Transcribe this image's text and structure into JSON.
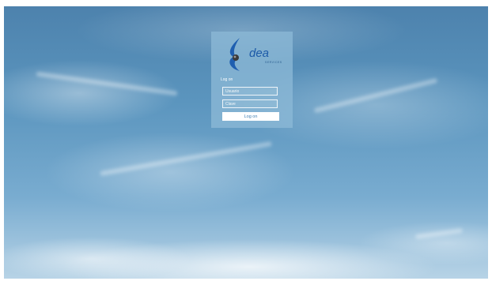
{
  "login": {
    "logo": {
      "name": "dea",
      "tagline": "SERVICES"
    },
    "heading": "Log on",
    "username": {
      "placeholder": "Usuario",
      "value": ""
    },
    "password": {
      "placeholder": "Clave",
      "value": ""
    },
    "submit_label": "Log on"
  },
  "colors": {
    "panel": "#8cb8d6",
    "button_text": "#3f7fb4",
    "logo_blue": "#1c5aa8"
  }
}
